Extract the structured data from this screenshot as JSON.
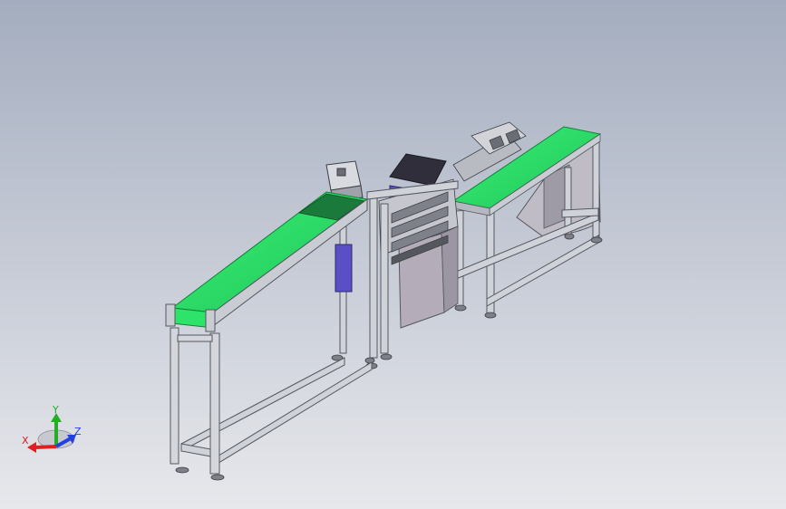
{
  "colors": {
    "background_top": "#a4adbf",
    "background_bottom": "#e7e8ec",
    "belt": "#2ee36a",
    "belt_dark": "#1aa34a",
    "frame": "#c9ccd3",
    "frame_dark": "#6f737c",
    "panel": "#b4acb9",
    "motor": "#5a4fc4",
    "axis_x": "#e02020",
    "axis_y": "#21b021",
    "axis_z": "#2040e0"
  },
  "triad": {
    "x_label": "X",
    "y_label": "Y",
    "z_label": "Z",
    "icon": "coordinate-triad-icon"
  }
}
